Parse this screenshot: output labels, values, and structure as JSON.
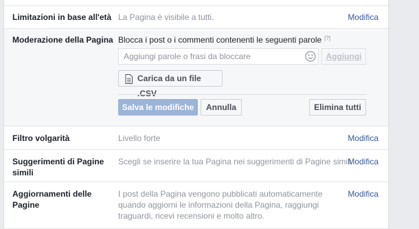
{
  "rows": {
    "age": {
      "label": "Limitazioni in base all'età",
      "value": "La Pagina è visibile a tutti.",
      "edit": "Modifica"
    },
    "moderation": {
      "label": "Moderazione della Pagina",
      "instruction": "Blocca i post o i commenti contenenti le seguenti parole",
      "help": "[?]",
      "input_placeholder": "Aggiungi parole o frasi da bloccare",
      "input_value": "",
      "add_label": "Aggiungi",
      "csv_label": "Carica da un file .CSV",
      "save_label": "Salva le modifiche",
      "cancel_label": "Annulla",
      "delete_all_label": "Elimina tutti"
    },
    "profanity": {
      "label": "Filtro volgarità",
      "value": "Livello forte",
      "edit": "Modifica"
    },
    "similar": {
      "label": "Suggerimenti di Pagine simili",
      "value": "Scegli se inserire la tua Pagina nei suggerimenti di Pagine simili",
      "edit": "Modifica"
    },
    "updates": {
      "label": "Aggiornamenti delle Pagine",
      "value": "I post della Pagina vengono pubblicati automaticamente quando aggiorni le informazioni della Pagina, raggiungi traguardi, ricevi recensioni e molto altro.",
      "edit": "Modifica"
    }
  },
  "icons": {
    "emoji": "smiley-icon",
    "document": "document-icon"
  },
  "colors": {
    "link": "#365899",
    "save_disabled": "#9cb4d8",
    "muted_text": "#90949c",
    "page_background": "#e9ebee"
  }
}
